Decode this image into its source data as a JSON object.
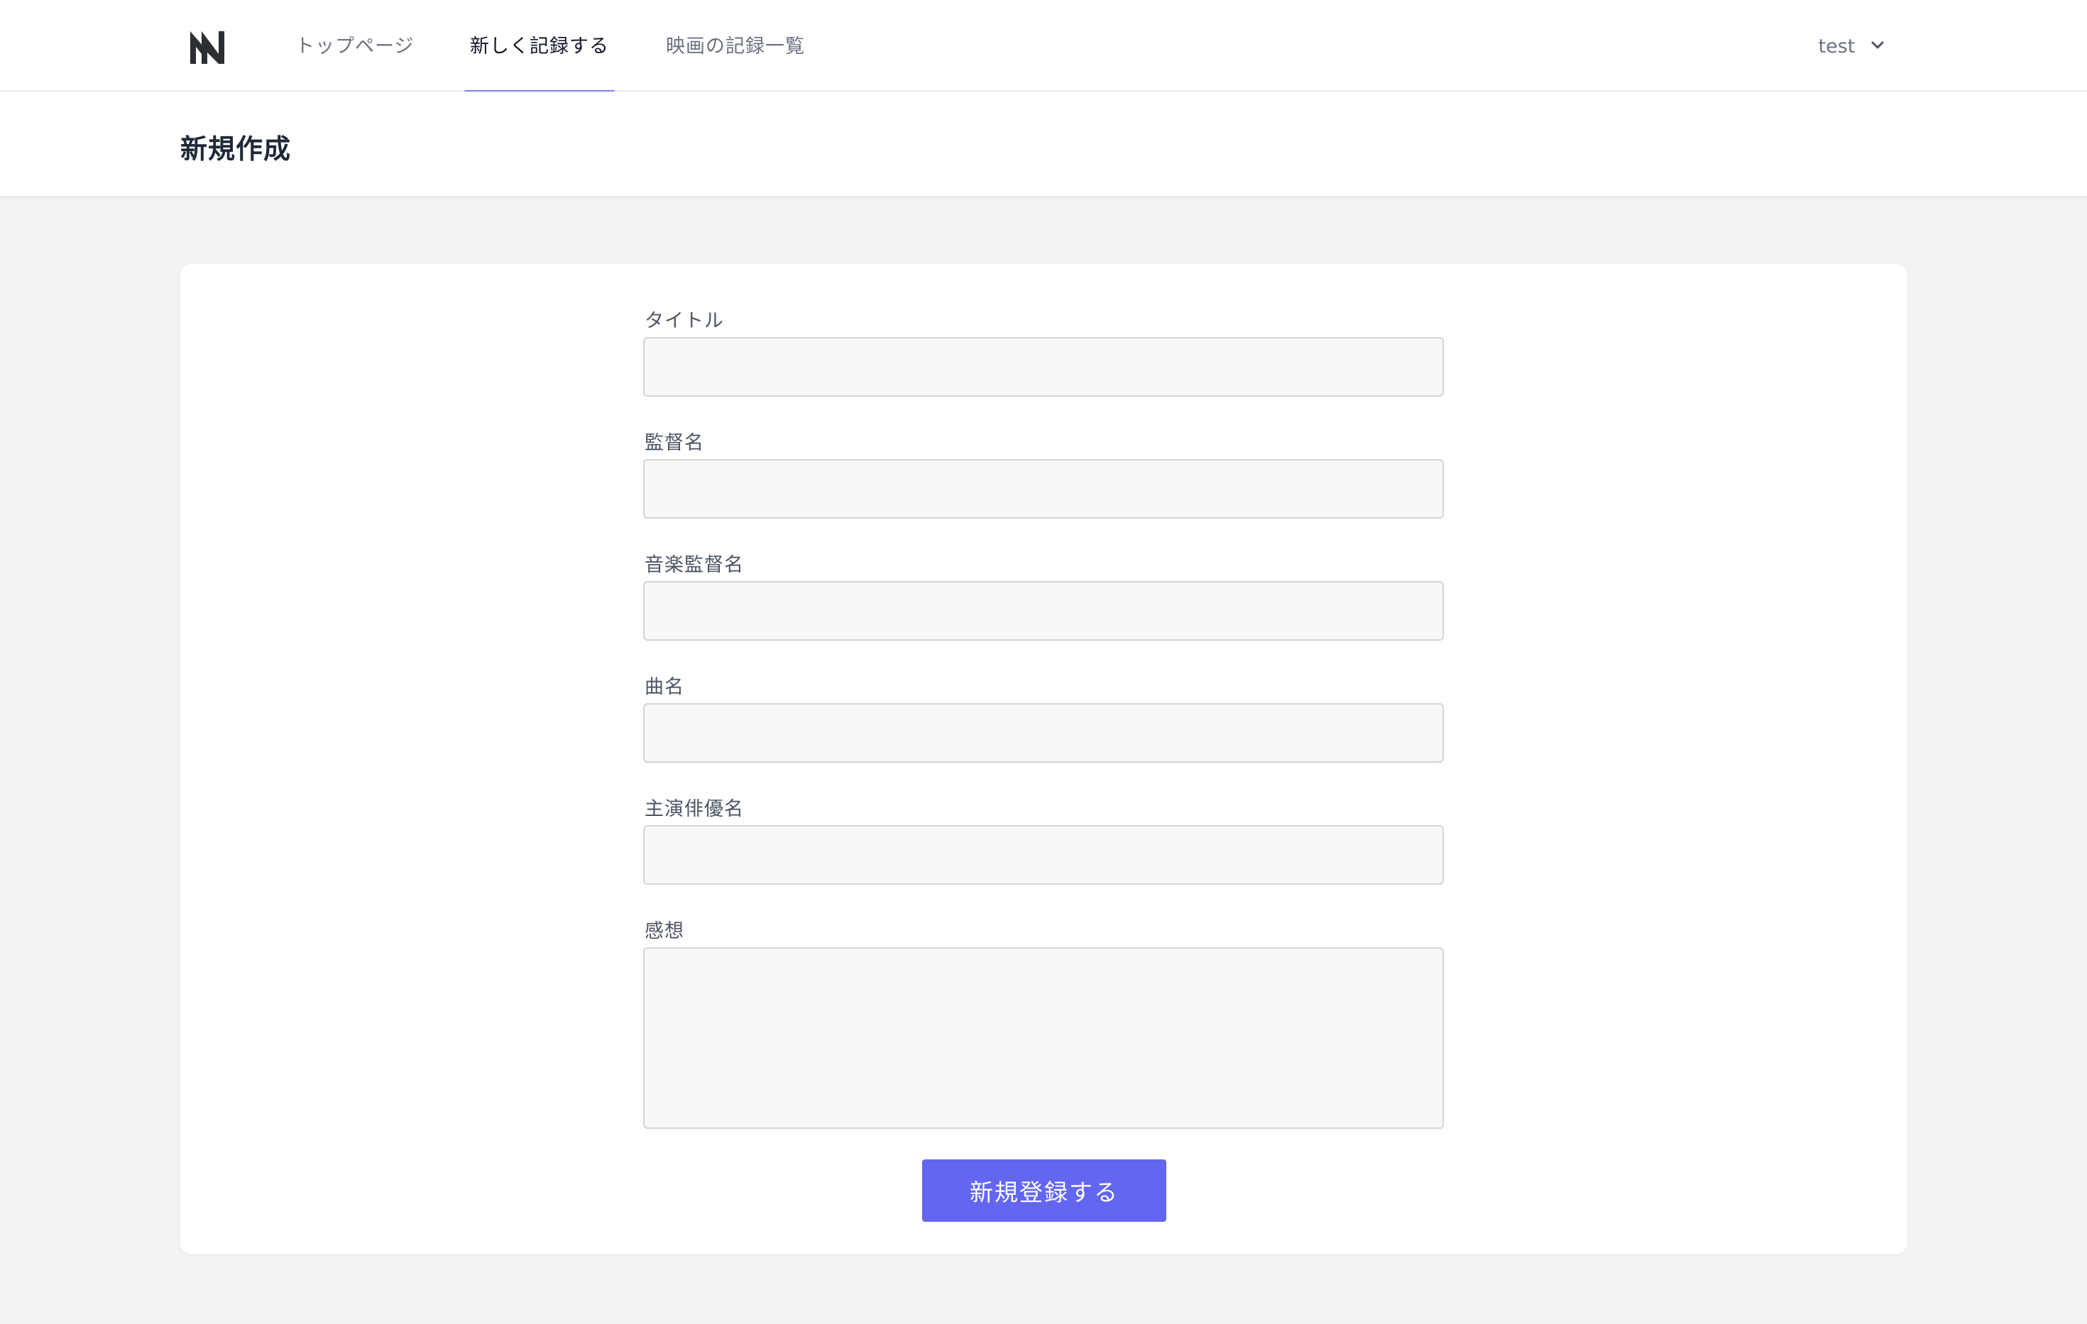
{
  "nav": {
    "logo_name": "app-logo-icon",
    "links": [
      {
        "label": "トップページ",
        "active": false
      },
      {
        "label": "新しく記録する",
        "active": true
      },
      {
        "label": "映画の記録一覧",
        "active": false
      }
    ],
    "user": {
      "name": "test",
      "icon": "chevron-down-icon"
    }
  },
  "header": {
    "title": "新規作成"
  },
  "form": {
    "fields": [
      {
        "label": "タイトル",
        "value": "",
        "type": "text"
      },
      {
        "label": "監督名",
        "value": "",
        "type": "text"
      },
      {
        "label": "音楽監督名",
        "value": "",
        "type": "text"
      },
      {
        "label": "曲名",
        "value": "",
        "type": "text"
      },
      {
        "label": "主演俳優名",
        "value": "",
        "type": "text"
      },
      {
        "label": "感想",
        "value": "",
        "type": "textarea"
      }
    ],
    "submit_label": "新規登録する"
  },
  "colors": {
    "accent": "#6366f1",
    "nav_underline": "#7c7ff0",
    "background": "#f2f3f5"
  }
}
